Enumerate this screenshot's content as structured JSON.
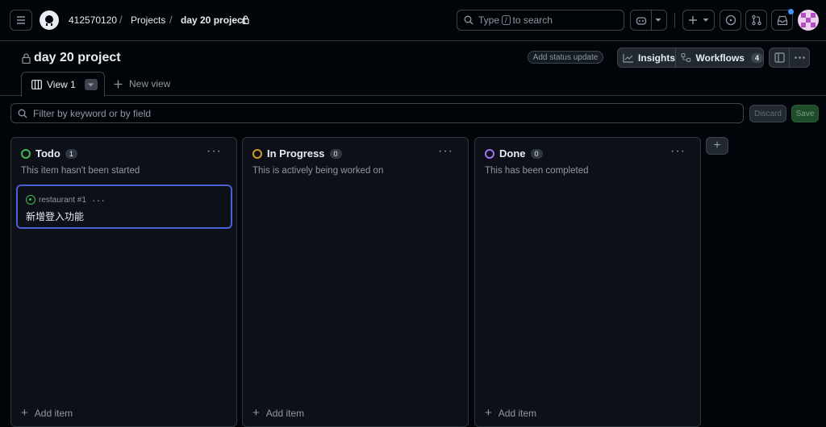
{
  "header": {
    "breadcrumbs": [
      "412570120",
      "Projects",
      "day 20 project"
    ],
    "search_prefix": "Type",
    "search_key": "/",
    "search_suffix": "to search"
  },
  "project": {
    "title": "day 20 project",
    "status_button": "Add status update",
    "insights_label": "Insights",
    "workflows_label": "Workflows",
    "workflows_count": "4"
  },
  "tabs": {
    "active_label": "View 1",
    "new_view_label": "New view"
  },
  "filter": {
    "placeholder": "Filter by keyword or by field",
    "discard_label": "Discard",
    "save_label": "Save"
  },
  "columns": [
    {
      "name": "Todo",
      "count": "1",
      "description": "This item hasn't been started",
      "color": "#3fb950",
      "add_label": "Add item"
    },
    {
      "name": "In Progress",
      "count": "0",
      "description": "This is actively being worked on",
      "color": "#d29922",
      "add_label": "Add item"
    },
    {
      "name": "Done",
      "count": "0",
      "description": "This has been completed",
      "color": "#a371f7",
      "add_label": "Add item"
    }
  ],
  "card": {
    "repo_ref": "restaurant #1",
    "title": "新增登入功能"
  },
  "colors": {
    "background": "#010409",
    "column_bg": "#0d1117",
    "border": "#30363d",
    "card_focus": "#4c5fd5",
    "save_green": "#238636"
  },
  "icons": [
    "menu-icon",
    "github-logo-icon",
    "lock-icon",
    "search-icon",
    "copilot-icon",
    "plus-icon",
    "issue-icon",
    "pull-request-icon",
    "inbox-icon",
    "avatar",
    "graph-icon",
    "workflow-icon",
    "panel-icon",
    "kebab-icon",
    "board-icon",
    "chevron-down-icon"
  ]
}
